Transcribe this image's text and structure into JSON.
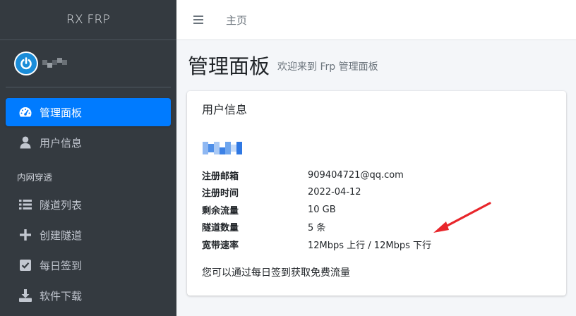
{
  "sidebar": {
    "brand": "RX FRP",
    "nav": [
      {
        "label": "管理面板",
        "icon": "dashboard-icon",
        "active": true
      },
      {
        "label": "用户信息",
        "icon": "user-icon",
        "active": false
      }
    ],
    "section_header": "内网穿透",
    "tunnel_nav": [
      {
        "label": "隧道列表",
        "icon": "list-icon"
      },
      {
        "label": "创建隧道",
        "icon": "plus-icon"
      },
      {
        "label": "每日签到",
        "icon": "checkbox-icon"
      },
      {
        "label": "软件下载",
        "icon": "download-icon"
      }
    ]
  },
  "topbar": {
    "home_label": "主页"
  },
  "page": {
    "title": "管理面板",
    "subtitle": "欢迎来到 Frp 管理面板"
  },
  "card": {
    "title": "用户信息",
    "rows": [
      {
        "label": "注册邮箱",
        "value": "909404721@qq.com"
      },
      {
        "label": "注册时间",
        "value": "2022-04-12"
      },
      {
        "label": "剩余流量",
        "value": "10 GB"
      },
      {
        "label": "隧道数量",
        "value": "5 条"
      },
      {
        "label": "宽带速率",
        "value": "12Mbps 上行 / 12Mbps 下行"
      }
    ],
    "note": "您可以通过每日签到获取免费流量"
  },
  "colors": {
    "sidebar_bg": "#343a40",
    "accent": "#007bff",
    "arrow": "#e8262b"
  }
}
